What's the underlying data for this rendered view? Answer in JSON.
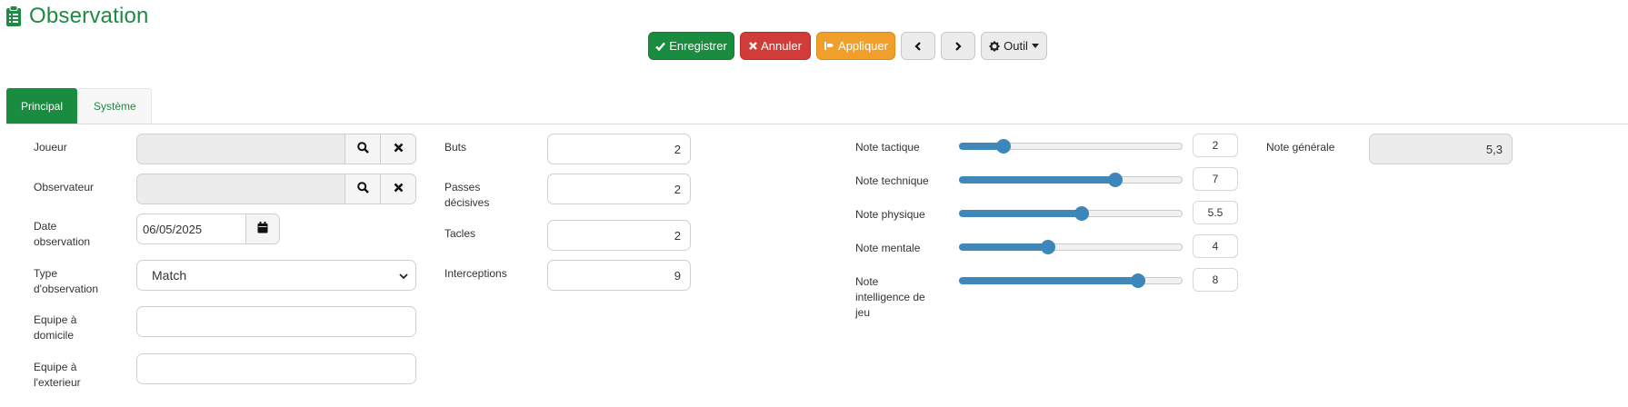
{
  "page": {
    "title": "Observation",
    "icon": "clipboard-list-icon",
    "accent": "#1a8c3f"
  },
  "toolbar": {
    "save_label": "Enregistrer",
    "cancel_label": "Annuler",
    "apply_label": "Appliquer",
    "tool_label": "Outil"
  },
  "tabs": [
    {
      "label": "Principal",
      "active": true
    },
    {
      "label": "Système",
      "active": false
    }
  ],
  "form": {
    "joueur": {
      "label": "Joueur",
      "value": ""
    },
    "observateur": {
      "label": "Observateur",
      "value": ""
    },
    "date": {
      "label_line1": "Date",
      "label_line2": "observation",
      "value": "06/05/2025"
    },
    "type": {
      "label_line1": "Type",
      "label_line2": "d'observation",
      "value": "Match"
    },
    "equipe_domicile": {
      "label_line1": "Equipe à",
      "label_line2": "domicile",
      "value": ""
    },
    "equipe_exterieur": {
      "label_line1": "Equipe à",
      "label_line2": "l'exterieur",
      "value": ""
    },
    "buts": {
      "label": "Buts",
      "value": "2"
    },
    "passes": {
      "label_line1": "Passes",
      "label_line2": "décisives",
      "value": "2"
    },
    "tacles": {
      "label": "Tacles",
      "value": "2"
    },
    "interceptions": {
      "label": "Interceptions",
      "value": "9"
    },
    "notes": [
      {
        "label_lines": [
          "Note tactique"
        ],
        "value": "2",
        "level": 0.2
      },
      {
        "label_lines": [
          "Note technique"
        ],
        "value": "7",
        "level": 0.7
      },
      {
        "label_lines": [
          "Note physique"
        ],
        "value": "5.5",
        "level": 0.55
      },
      {
        "label_lines": [
          "Note mentale"
        ],
        "value": "4",
        "level": 0.4
      },
      {
        "label_lines": [
          "Note",
          "intelligence de",
          "jeu"
        ],
        "value": "8",
        "level": 0.8
      }
    ],
    "note_generale": {
      "label": "Note générale",
      "value": "5,3"
    }
  }
}
